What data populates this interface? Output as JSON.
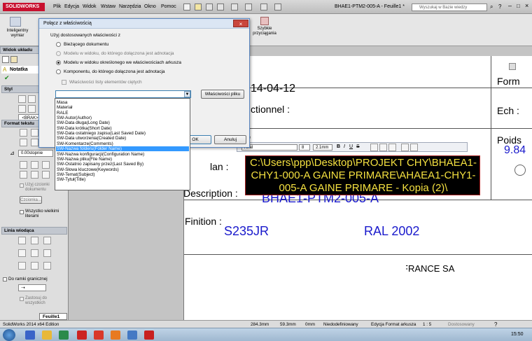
{
  "titlebar": {
    "app_name": "SOLIDWORKS",
    "menus": [
      "Plik",
      "Edycja",
      "Widok",
      "Wstaw",
      "Narzędzia",
      "Okno",
      "Pomoc"
    ],
    "document_title": "BHAE1-PTM2-005-A - Feuille1 *",
    "search_placeholder": "Wyszukaj w Bazie wiedzy"
  },
  "ribbon": {
    "smart_dimension": "Inteligentny wymiar",
    "quick_snaps": "Szybkie przyciągania"
  },
  "left_panel": {
    "view_layout": "Widok układu",
    "note_header": "Notatka",
    "style_header": "Styl",
    "style_value": "<BRAK>",
    "text_format_header": "Format tekstu",
    "angle_value": "0.00stopnie",
    "use_doc_font": "Użyj czcionki dokumentu",
    "font_button": "Czcionka...",
    "all_uppercase": "Wszystko wielkimi literami",
    "leader_header": "Linia wiodąca",
    "to_border": "Do ramki granicznej",
    "apply_all": "Zastosuj do wszystkich",
    "sheet_tab": "Feuille1"
  },
  "dialog": {
    "title": "Połącz z właściwością",
    "group_label": "Użyj dostosowanych właściwości z",
    "options": [
      {
        "label": "Bieżącego dokumentu",
        "selected": false,
        "disabled": false
      },
      {
        "label": "Modelu w widoku, do którego dołączona jest adnotacja",
        "selected": false,
        "disabled": true
      },
      {
        "label": "Modelu w widoku określonego we właściwościach arkusza",
        "selected": true,
        "disabled": false
      },
      {
        "label": "Komponentu, do którego dołączona jest adnotacja",
        "selected": false,
        "disabled": false
      }
    ],
    "checkbox_cut_list": "Właściwości listy elementów ciętych",
    "properties_button": "Właściwości pliku",
    "ok_button": "OK",
    "cancel_button": "Anuluj",
    "dropdown_items": [
      "Masa",
      "Materiał",
      "RALE",
      "SW-Autor(Author)",
      "SW-Data długa(Long Date)",
      "SW-Data krótka(Short Date)",
      "SW-Data ostatniego zapisu(Last Saved Date)",
      "SW-Data utworzenia(Created Date)",
      "SW-Komentarze(Comments)",
      "SW-Nazwa folderu(Folder Name)",
      "SW-Nazwa konfiguracji(Configuration Name)",
      "SW-Nazwa pliku(File Name)",
      "SW-Ostatnio zapisany przez(Last Saved By)",
      "SW-Słowa kluczowe(Keywords)",
      "SW-Temat(Subject)",
      "SW-Tytuł(Title)"
    ],
    "selected_item_index": 9
  },
  "format_bar": {
    "title_fragment": "wanie",
    "font": "Arial",
    "size": "8",
    "height": "2.1mm"
  },
  "drawing": {
    "date_fragment": "14-04-12",
    "functional_label": "ctionnel :",
    "plan_label": "lan :",
    "description_label": "Description :",
    "description_value": "BHAE1-PTM2-005-A",
    "finition_label": "Finition :",
    "material_value": "S235JR",
    "color_value": "RAL 2002",
    "format_label": "Form",
    "ech_label": "Ech :",
    "poids_label": "Poids",
    "poids_value": "9.84",
    "company_fragment": "FRANCE SA",
    "note_lines": [
      "C:\\Users\\ppp\\Desktop\\PROJEKT CHY\\BHAEA1-",
      "CHY1-000-A  GAINE PRIMARE\\AHAEA1-CHY1-",
      "005-A  GAINE PRIMARE - Kopia (2)\\"
    ]
  },
  "status_bar": {
    "edition": "SolidWorks 2014 x64 Edition",
    "x": "284.3mm",
    "y": "59.3mm",
    "z": "0mm",
    "defined": "Niedodefiniowany",
    "editing": "Edycja Format arkusza",
    "scale": "1 : 5",
    "custom": "Dostosowany",
    "clock": "15:50"
  }
}
